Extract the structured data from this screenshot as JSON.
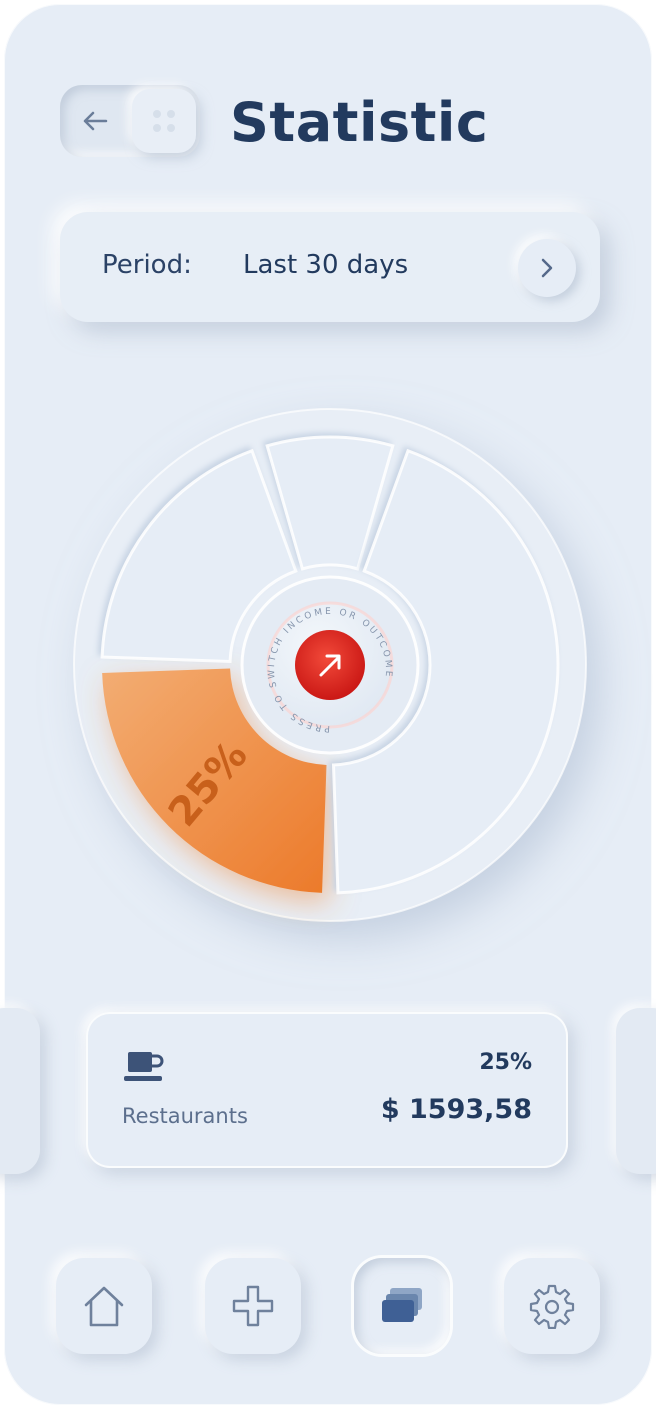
{
  "header": {
    "title": "Statistic",
    "back_icon": "arrow-left-icon",
    "grid_icon": "grid-dots-icon"
  },
  "period": {
    "label": "Period:",
    "value": "Last 30 days",
    "arrow_icon": "chevron-right-icon"
  },
  "chart": {
    "center_button_text": "PRESS TO SWITCH INCOME OR OUTCOME",
    "center_button_icon": "arrow-up-right-icon",
    "highlight_label": "25%",
    "accent_color": "#ee8031",
    "button_color": "#d81a1a"
  },
  "chart_data": {
    "type": "pie",
    "segments": [
      {
        "label": "25%",
        "value": 25,
        "highlighted": true
      },
      {
        "label": "",
        "value": 20
      },
      {
        "label": "",
        "value": 10
      },
      {
        "label": "",
        "value": 45
      }
    ]
  },
  "category": {
    "icon": "coffee-cup-icon",
    "name": "Restaurants",
    "percent": "25%",
    "amount": "$ 1593,58"
  },
  "nav": {
    "items": [
      {
        "name": "home",
        "icon": "home-icon",
        "active": false
      },
      {
        "name": "add",
        "icon": "plus-icon",
        "active": false
      },
      {
        "name": "cards",
        "icon": "cards-icon",
        "active": true
      },
      {
        "name": "settings",
        "icon": "gear-icon",
        "active": false
      }
    ]
  }
}
